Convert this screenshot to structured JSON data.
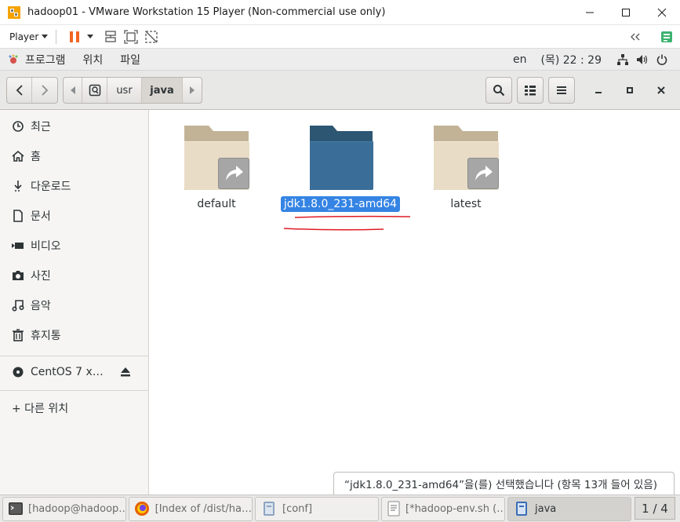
{
  "vmware": {
    "title": "hadoop01 - VMware Workstation 15 Player (Non-commercial use only)",
    "player_menu": "Player"
  },
  "gnome": {
    "menus": [
      "프로그램",
      "위치",
      "파일"
    ],
    "input_lang": "en",
    "clock": "(목) 22 : 29"
  },
  "path": {
    "segments": [
      "usr",
      "java"
    ],
    "active": "java"
  },
  "sidebar": {
    "items": [
      {
        "label": "최근",
        "icon": "clock-icon"
      },
      {
        "label": "홈",
        "icon": "home-icon"
      },
      {
        "label": "다운로드",
        "icon": "download-icon"
      },
      {
        "label": "문서",
        "icon": "document-icon"
      },
      {
        "label": "비디오",
        "icon": "video-icon"
      },
      {
        "label": "사진",
        "icon": "camera-icon"
      },
      {
        "label": "음악",
        "icon": "music-icon"
      },
      {
        "label": "휴지통",
        "icon": "trash-icon"
      }
    ],
    "device": {
      "label": "CentOS 7 x…",
      "icon": "disc-icon"
    },
    "other": {
      "label": "+ 다른 위치"
    }
  },
  "files": [
    {
      "name": "default",
      "type": "symlink-folder",
      "selected": false
    },
    {
      "name": "jdk1.8.0_231-amd64",
      "type": "folder",
      "selected": true
    },
    {
      "name": "latest",
      "type": "symlink-folder",
      "selected": false
    }
  ],
  "status": "“jdk1.8.0_231-amd64”을(를) 선택했습니다 (항목 13개 들어 있음)",
  "taskbar": {
    "tasks": [
      {
        "label": "[hadoop@hadoop…",
        "icon": "terminal-icon",
        "active": false
      },
      {
        "label": "[Index of /dist/ha…",
        "icon": "firefox-icon",
        "active": false
      },
      {
        "label": "[conf]",
        "icon": "file-manager-icon",
        "active": false
      },
      {
        "label": "[*hadoop-env.sh (…",
        "icon": "text-editor-icon",
        "active": false
      },
      {
        "label": "java",
        "icon": "file-manager-icon",
        "active": true
      }
    ],
    "pager": "1 / 4"
  },
  "colors": {
    "selection": "#3584e4",
    "folder_selected": "#3a6e98",
    "folder_normal": "#e8dcc6",
    "annotation": "#e01b24"
  }
}
